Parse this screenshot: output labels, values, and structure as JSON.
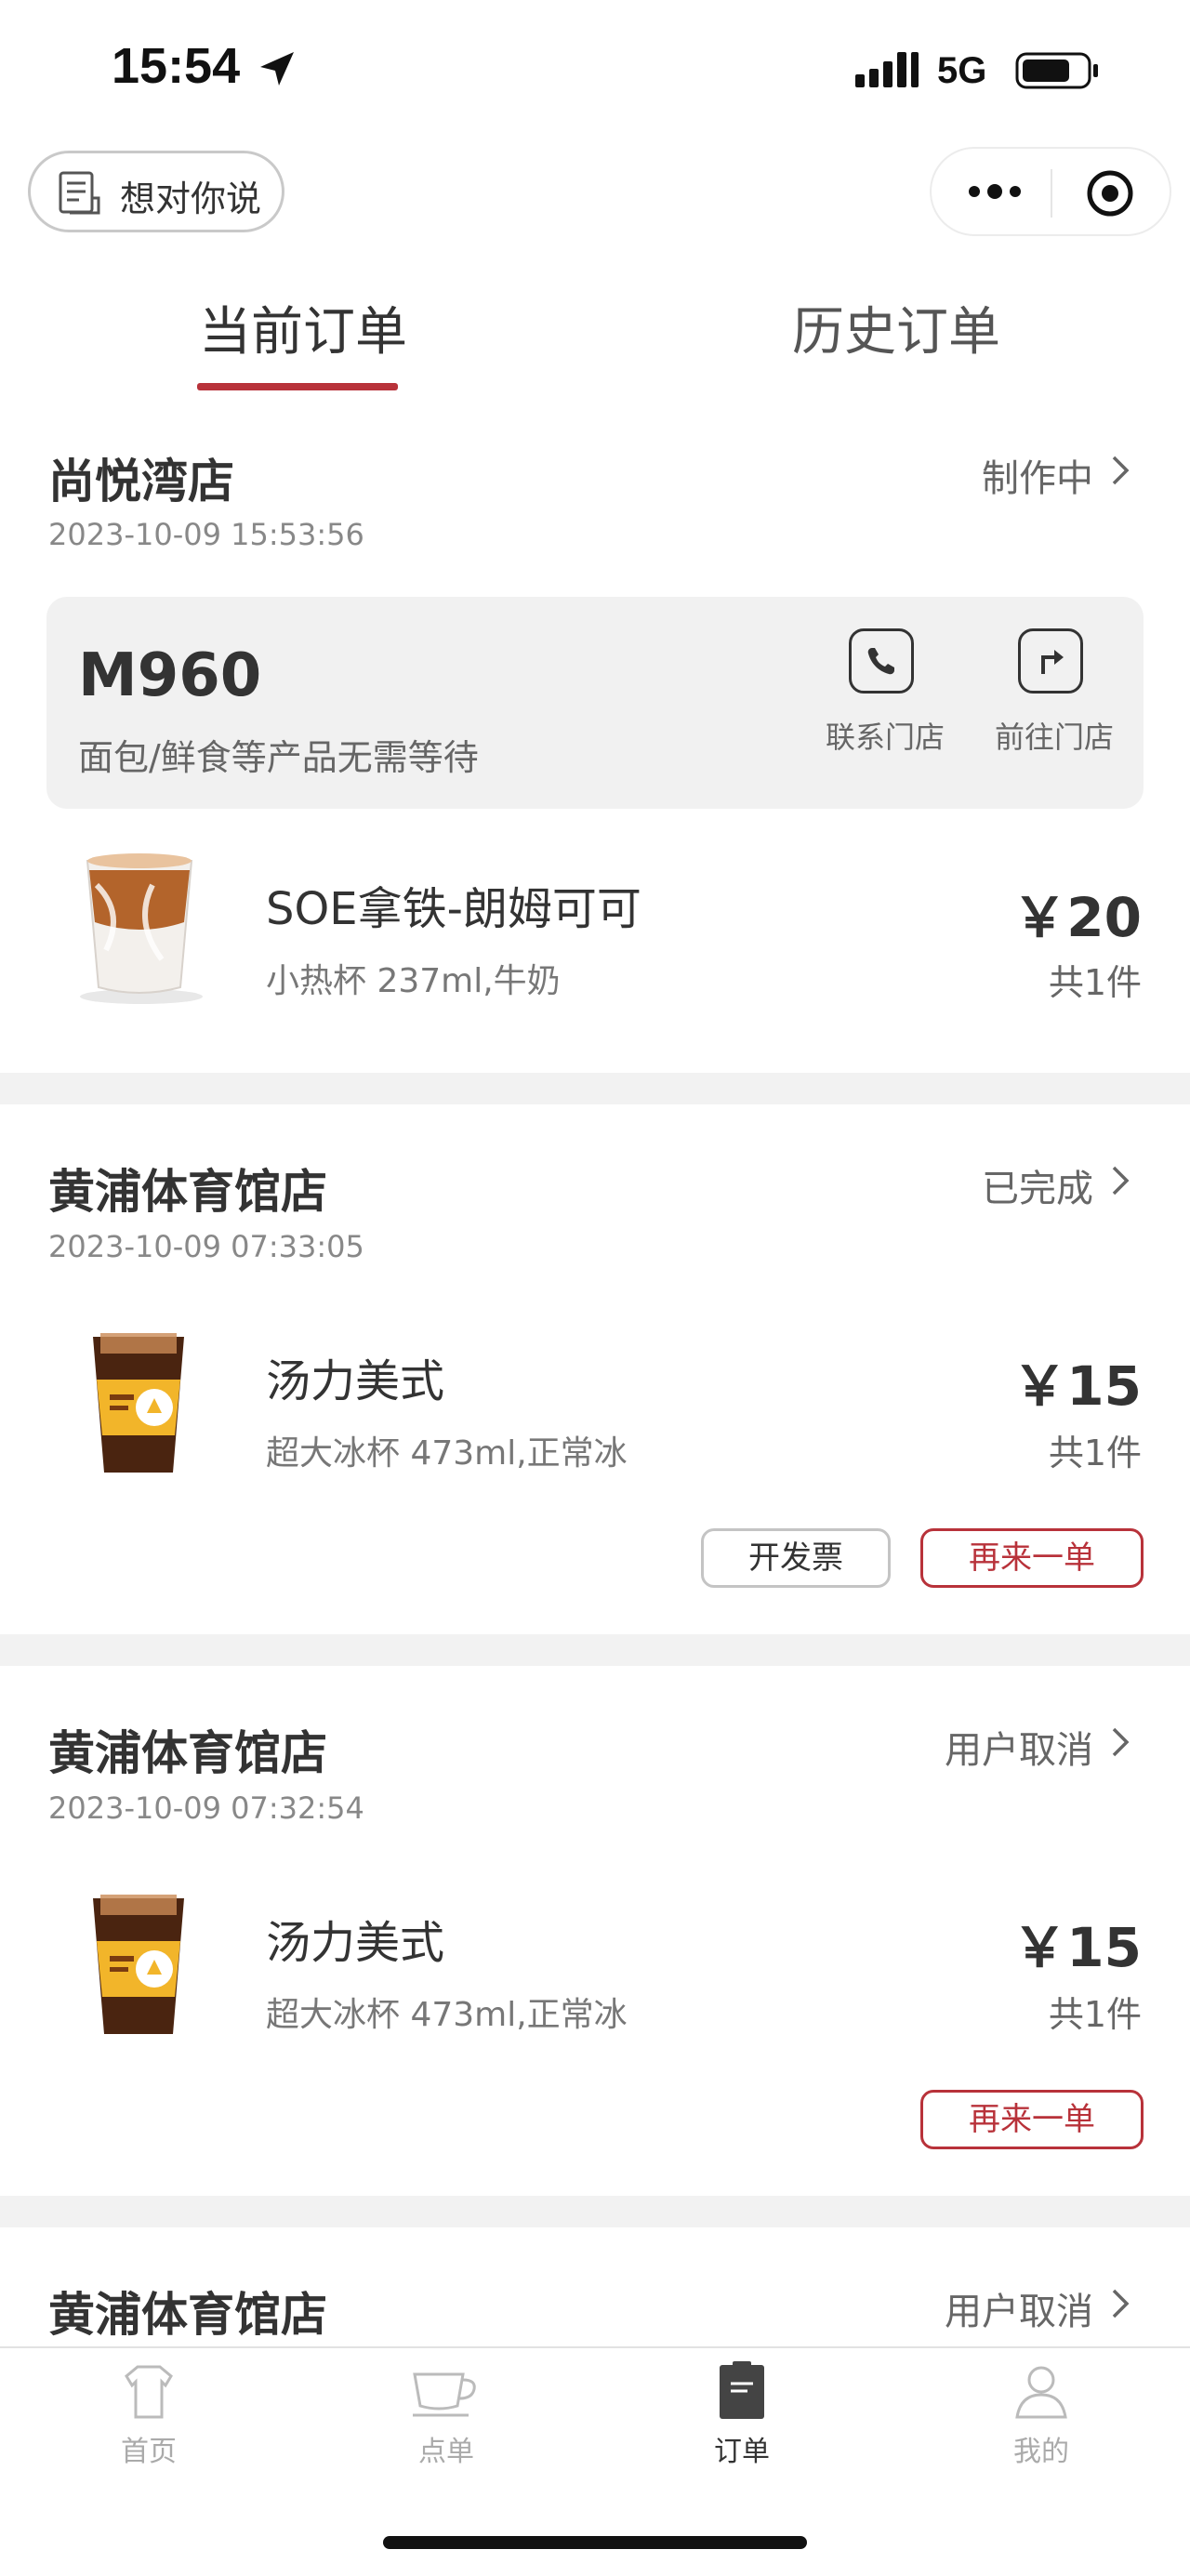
{
  "status_bar": {
    "time": "15:54",
    "network": "5G"
  },
  "header": {
    "feedback_label": "想对你说"
  },
  "tabs": [
    {
      "label": "当前订单",
      "active": true
    },
    {
      "label": "历史订单",
      "active": false
    }
  ],
  "accent_color": "#b8323a",
  "orders": [
    {
      "store": "尚悦湾店",
      "datetime": "2023-10-09 15:53:56",
      "status": "制作中",
      "pickup": {
        "code": "M960",
        "note": "面包/鲜食等产品无需等待",
        "actions": [
          {
            "label": "联系门店",
            "icon": "phone-icon"
          },
          {
            "label": "前往门店",
            "icon": "directions-icon"
          }
        ]
      },
      "item": {
        "name": "SOE拿铁-朗姆可可",
        "spec": "小热杯 237ml,牛奶",
        "price": "￥20",
        "qty": "共1件",
        "image": "latte-cup"
      }
    },
    {
      "store": "黄浦体育馆店",
      "datetime": "2023-10-09 07:33:05",
      "status": "已完成",
      "item": {
        "name": "汤力美式",
        "spec": "超大冰杯 473ml,正常冰",
        "price": "￥15",
        "qty": "共1件",
        "image": "iced-americano-cup"
      },
      "buttons": {
        "invoice": "开发票",
        "reorder": "再来一单"
      }
    },
    {
      "store": "黄浦体育馆店",
      "datetime": "2023-10-09 07:32:54",
      "status": "用户取消",
      "item": {
        "name": "汤力美式",
        "spec": "超大冰杯 473ml,正常冰",
        "price": "￥15",
        "qty": "共1件",
        "image": "iced-americano-cup"
      },
      "buttons": {
        "reorder": "再来一单"
      }
    },
    {
      "store": "黄浦体育馆店",
      "status": "用户取消"
    }
  ],
  "bottom_nav": [
    {
      "label": "首页",
      "icon": "shirt-icon",
      "active": false
    },
    {
      "label": "点单",
      "icon": "coffee-cup-icon",
      "active": false
    },
    {
      "label": "订单",
      "icon": "order-clipboard-icon",
      "active": true
    },
    {
      "label": "我的",
      "icon": "profile-icon",
      "active": false
    }
  ]
}
